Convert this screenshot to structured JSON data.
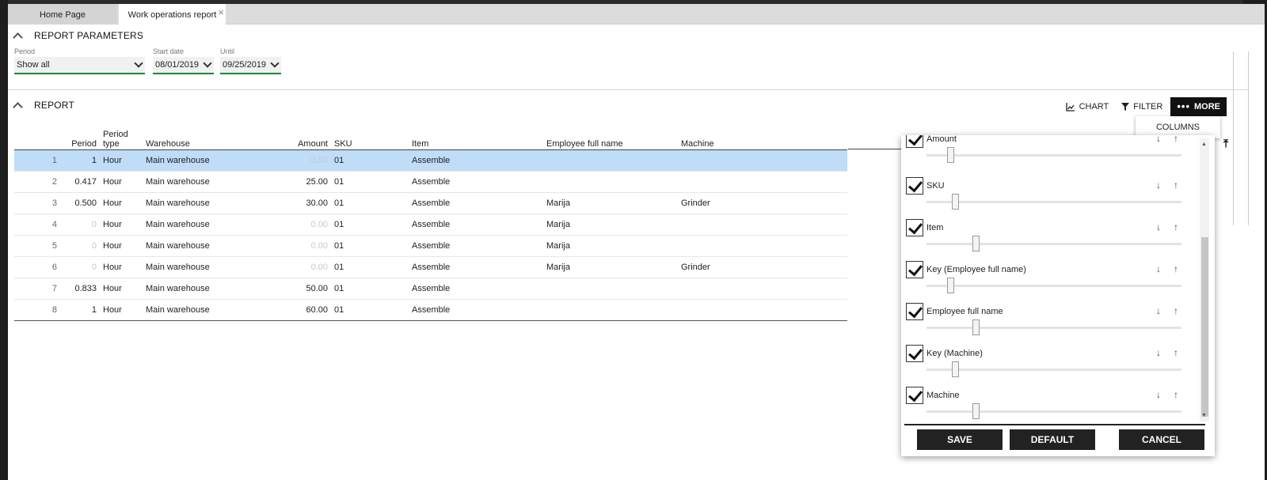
{
  "tabs": [
    {
      "label": "Home Page"
    },
    {
      "label": "Work operations report"
    }
  ],
  "tab_close_glyph": "×",
  "params": {
    "title": "REPORT PARAMETERS",
    "period_label": "Period",
    "period_value": "Show all",
    "start_label": "Start date",
    "start_value": "08/01/2019",
    "until_label": "Until",
    "until_value": "09/25/2019"
  },
  "report": {
    "title": "REPORT",
    "toolbar": {
      "chart": "CHART",
      "filter": "FILTER",
      "more": "MORE"
    },
    "columns_menu": "COLUMNS"
  },
  "table": {
    "headers": {
      "period": "Period",
      "period_type_1": "Period",
      "period_type_2": "type",
      "warehouse": "Warehouse",
      "amount": "Amount",
      "sku": "SKU",
      "item": "Item",
      "employee": "Employee full name",
      "machine": "Machine"
    },
    "rows": [
      {
        "n": "1",
        "period": "1",
        "type": "Hour",
        "warehouse": "Main warehouse",
        "amount": "0.00",
        "sku": "01",
        "item": "Assemble",
        "employee": "",
        "machine": ""
      },
      {
        "n": "2",
        "period": "0.417",
        "type": "Hour",
        "warehouse": "Main warehouse",
        "amount": "25.00",
        "sku": "01",
        "item": "Assemble",
        "employee": "",
        "machine": ""
      },
      {
        "n": "3",
        "period": "0.500",
        "type": "Hour",
        "warehouse": "Main warehouse",
        "amount": "30.00",
        "sku": "01",
        "item": "Assemble",
        "employee": "Marija",
        "machine": "Grinder"
      },
      {
        "n": "4",
        "period": "0",
        "type": "Hour",
        "warehouse": "Main warehouse",
        "amount": "0.00",
        "sku": "01",
        "item": "Assemble",
        "employee": "Marija",
        "machine": ""
      },
      {
        "n": "5",
        "period": "0",
        "type": "Hour",
        "warehouse": "Main warehouse",
        "amount": "0.00",
        "sku": "01",
        "item": "Assemble",
        "employee": "Marija",
        "machine": ""
      },
      {
        "n": "6",
        "period": "0",
        "type": "Hour",
        "warehouse": "Main warehouse",
        "amount": "0.00",
        "sku": "01",
        "item": "Assemble",
        "employee": "Marija",
        "machine": "Grinder"
      },
      {
        "n": "7",
        "period": "0.833",
        "type": "Hour",
        "warehouse": "Main warehouse",
        "amount": "50.00",
        "sku": "01",
        "item": "Assemble",
        "employee": "",
        "machine": ""
      },
      {
        "n": "8",
        "period": "1",
        "type": "Hour",
        "warehouse": "Main warehouse",
        "amount": "60.00",
        "sku": "01",
        "item": "Assemble",
        "employee": "",
        "machine": ""
      }
    ]
  },
  "columns_panel": {
    "items": [
      {
        "label": "Amount",
        "checked": true
      },
      {
        "label": "SKU",
        "checked": true
      },
      {
        "label": "Item",
        "checked": true
      },
      {
        "label": "Key (Employee full name)",
        "checked": true
      },
      {
        "label": "Employee full name",
        "checked": true
      },
      {
        "label": "Key (Machine)",
        "checked": true
      },
      {
        "label": "Machine",
        "checked": true
      }
    ],
    "down_glyph": "↓",
    "up_glyph": "↑",
    "save": "SAVE",
    "default": "DEFAULT",
    "cancel": "CANCEL"
  },
  "colors": {
    "accent_green": "#1a8a3a",
    "selected_row": "#bfdcf8",
    "button_dark": "#222222"
  }
}
